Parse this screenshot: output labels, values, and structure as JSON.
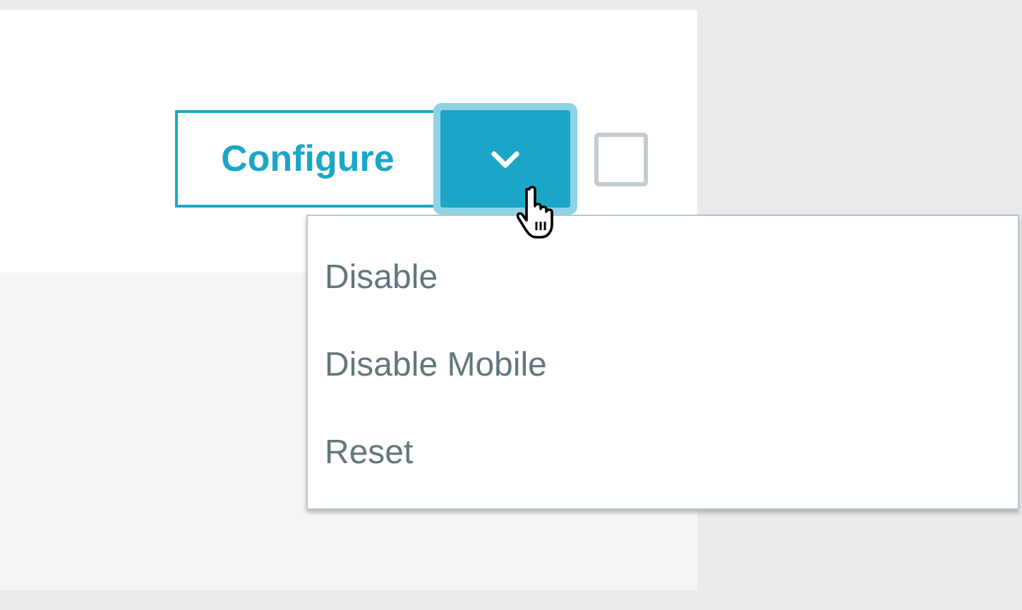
{
  "configure_button": {
    "label": "Configure"
  },
  "dropdown_toggle": {
    "expanded": true
  },
  "checkbox": {
    "checked": false
  },
  "menu": {
    "items": [
      {
        "label": "Disable"
      },
      {
        "label": "Disable Mobile"
      },
      {
        "label": "Reset"
      }
    ]
  }
}
